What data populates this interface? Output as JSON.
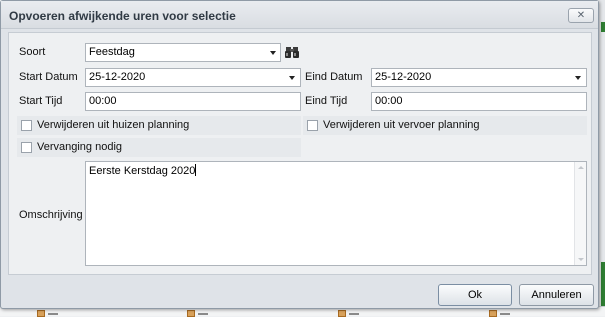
{
  "dialog": {
    "title": "Opvoeren afwijkende uren voor selectie",
    "close_label": "✕"
  },
  "form": {
    "soort_label": "Soort",
    "soort_value": "Feestdag",
    "start_datum_label": "Start Datum",
    "start_datum_value": "25-12-2020",
    "eind_datum_label": "Eind Datum",
    "eind_datum_value": "25-12-2020",
    "start_tijd_label": "Start Tijd",
    "start_tijd_value": "00:00",
    "eind_tijd_label": "Eind Tijd",
    "eind_tijd_value": "00:00",
    "verwijderen_huizen_label": "Verwijderen uit huizen planning",
    "verwijderen_huizen_checked": false,
    "verwijderen_vervoer_label": "Verwijderen uit vervoer planning",
    "verwijderen_vervoer_checked": false,
    "vervanging_label": "Vervanging nodig",
    "vervanging_checked": false,
    "omschrijving_label": "Omschrijving",
    "omschrijving_value": "Eerste Kerstdag 2020"
  },
  "buttons": {
    "ok_label": "Ok",
    "cancel_label": "Annuleren"
  },
  "icons": {
    "lookup": "binoculars-icon",
    "dropdown": "chevron-down-icon",
    "close": "close-icon"
  }
}
